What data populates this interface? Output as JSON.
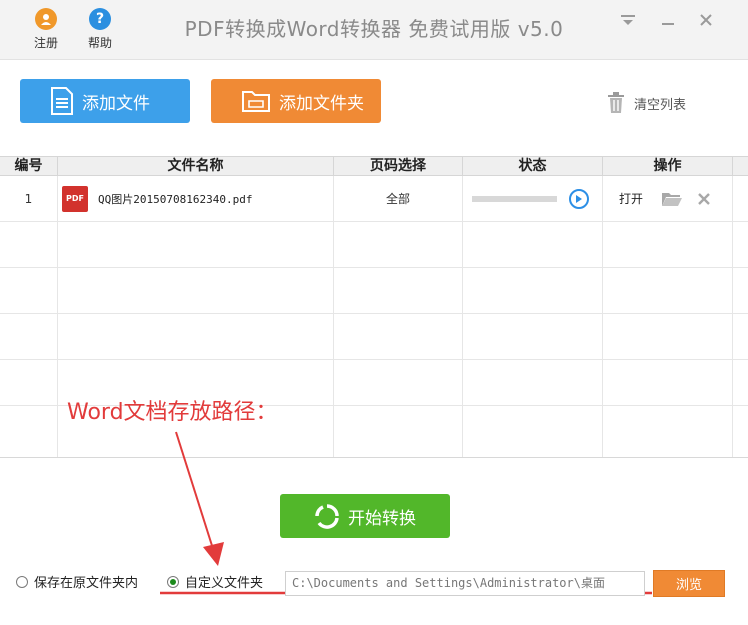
{
  "titlebar": {
    "register_label": "注册",
    "help_label": "帮助",
    "app_title": "PDF转换成Word转换器 免费试用版 v5.0"
  },
  "toolbar": {
    "add_file_label": "添加文件",
    "add_folder_label": "添加文件夹",
    "clear_list_label": "清空列表"
  },
  "table": {
    "columns": [
      "编号",
      "文件名称",
      "页码选择",
      "状态",
      "操作"
    ],
    "rows": [
      {
        "index": "1",
        "file_icon_label": "PDF",
        "file_name": "QQ图片20150708162340.pdf",
        "page_selection": "全部",
        "progress": 0,
        "open_label": "打开"
      }
    ]
  },
  "annotation": {
    "text": "Word文档存放路径："
  },
  "start": {
    "label": "开始转换"
  },
  "save_options": {
    "original_folder_label": "保存在原文件夹内",
    "custom_folder_label": "自定义文件夹",
    "selected": "custom",
    "path_value": "C:\\Documents and Settings\\Administrator\\桌面",
    "browse_label": "浏览"
  },
  "colors": {
    "blue_button": "#3da0ea",
    "orange_button": "#f08a35",
    "green_button": "#52b72a",
    "annotation_red": "#e23b3b"
  }
}
